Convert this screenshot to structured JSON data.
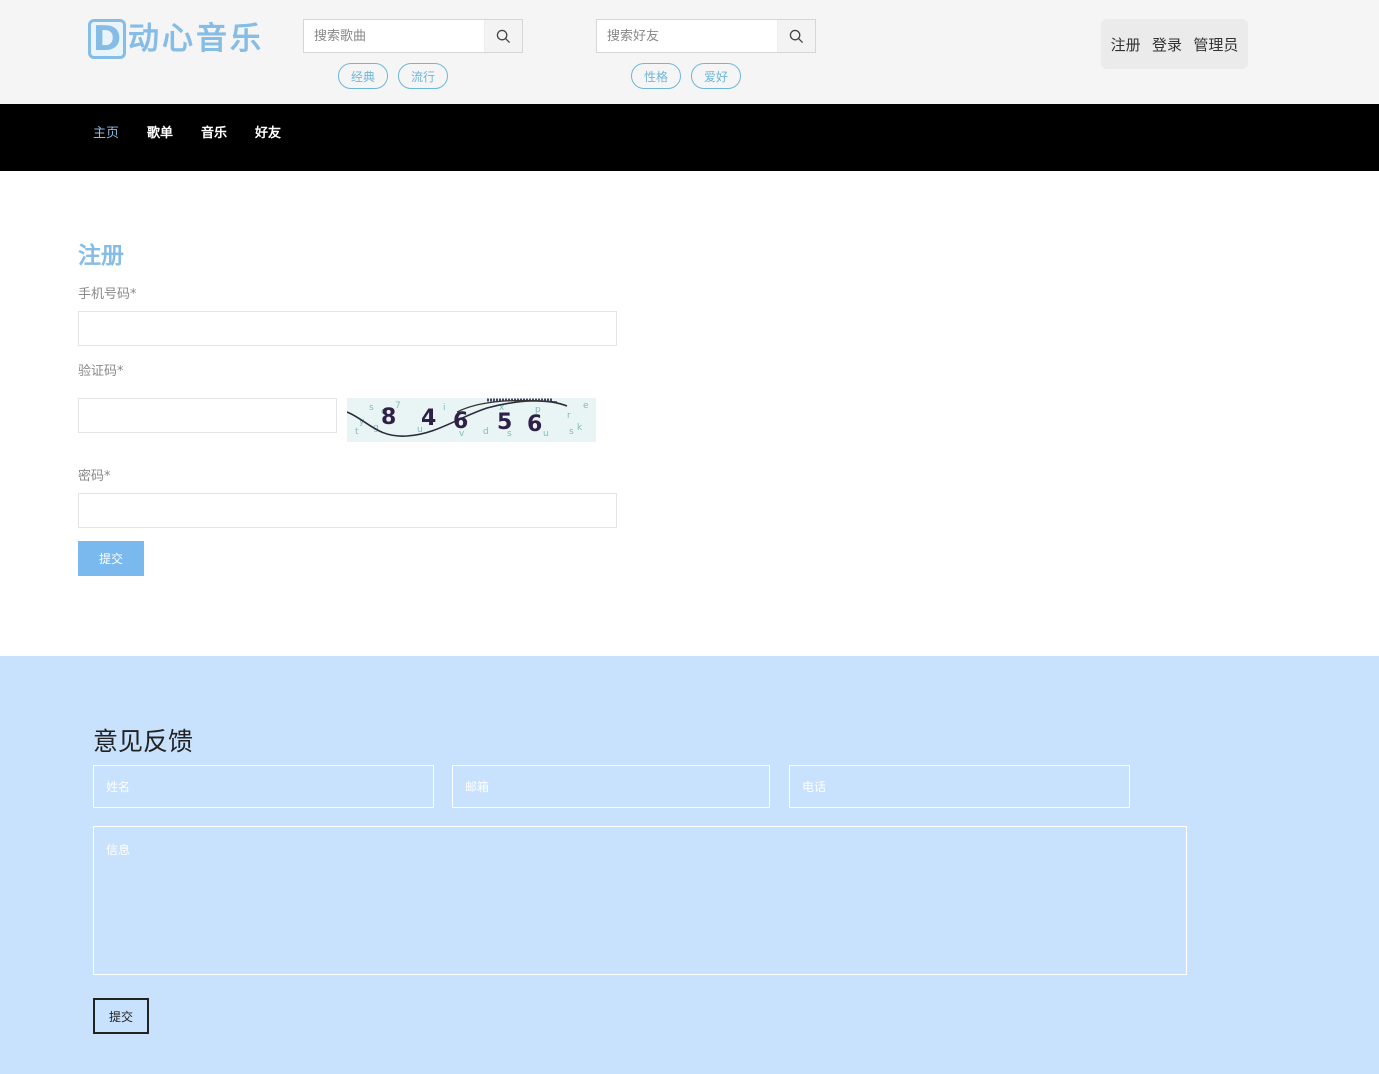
{
  "header": {
    "logo_letter": "D",
    "logo_text": "动心音乐",
    "search_songs": {
      "placeholder": "搜索歌曲"
    },
    "search_friends": {
      "placeholder": "搜索好友"
    },
    "song_tags": [
      "经典",
      "流行"
    ],
    "friend_tags": [
      "性格",
      "爱好"
    ],
    "auth": {
      "register": "注册",
      "login": "登录",
      "admin": "管理员"
    }
  },
  "nav": {
    "items": [
      "主页",
      "歌单",
      "音乐",
      "好友"
    ],
    "active": "主页"
  },
  "register": {
    "title": "注册",
    "phone_label": "手机号码*",
    "phone_value": "",
    "code_label": "验证码*",
    "code_value": "",
    "captcha_digits": [
      "8",
      "4",
      "6",
      "5",
      "6"
    ],
    "password_label": "密码*",
    "password_value": "",
    "submit": "提交"
  },
  "feedback": {
    "title": "意见反馈",
    "name_placeholder": "姓名",
    "email_placeholder": "邮箱",
    "phone_placeholder": "电话",
    "message_placeholder": "信息",
    "submit": "提交"
  },
  "colors": {
    "accent": "#86bde6",
    "nav_bg": "#000000",
    "feedback_bg": "#c8e1fc",
    "button": "#79b9ee"
  }
}
